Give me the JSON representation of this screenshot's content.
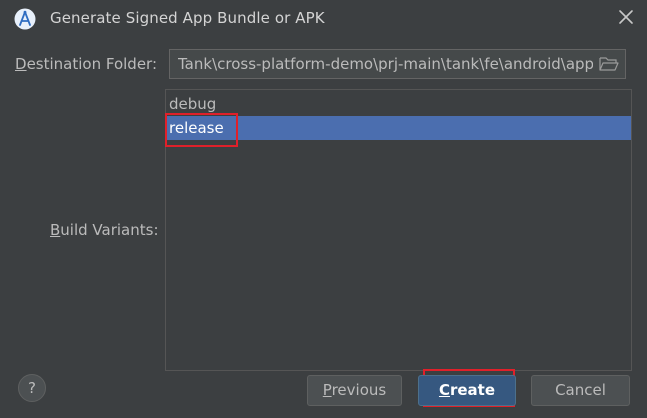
{
  "window": {
    "title": "Generate Signed App Bundle or APK",
    "app_icon": "android-studio-icon",
    "close_icon": "close-icon"
  },
  "destination": {
    "label": "Destination Folder:",
    "value": "Tank\\cross-platform-demo\\prj-main\\tank\\fe\\android\\app",
    "browse_icon": "folder-icon"
  },
  "build_variants": {
    "label": "Build Variants:",
    "items": [
      {
        "label": "debug",
        "selected": false
      },
      {
        "label": "release",
        "selected": true
      }
    ]
  },
  "footer": {
    "help_label": "?",
    "previous_label": "Previous",
    "create_label": "Create",
    "cancel_label": "Cancel"
  },
  "colors": {
    "background": "#3c3f41",
    "selection": "#4b6eaf",
    "primary_button": "#365880",
    "annotation": "#e0202a"
  }
}
